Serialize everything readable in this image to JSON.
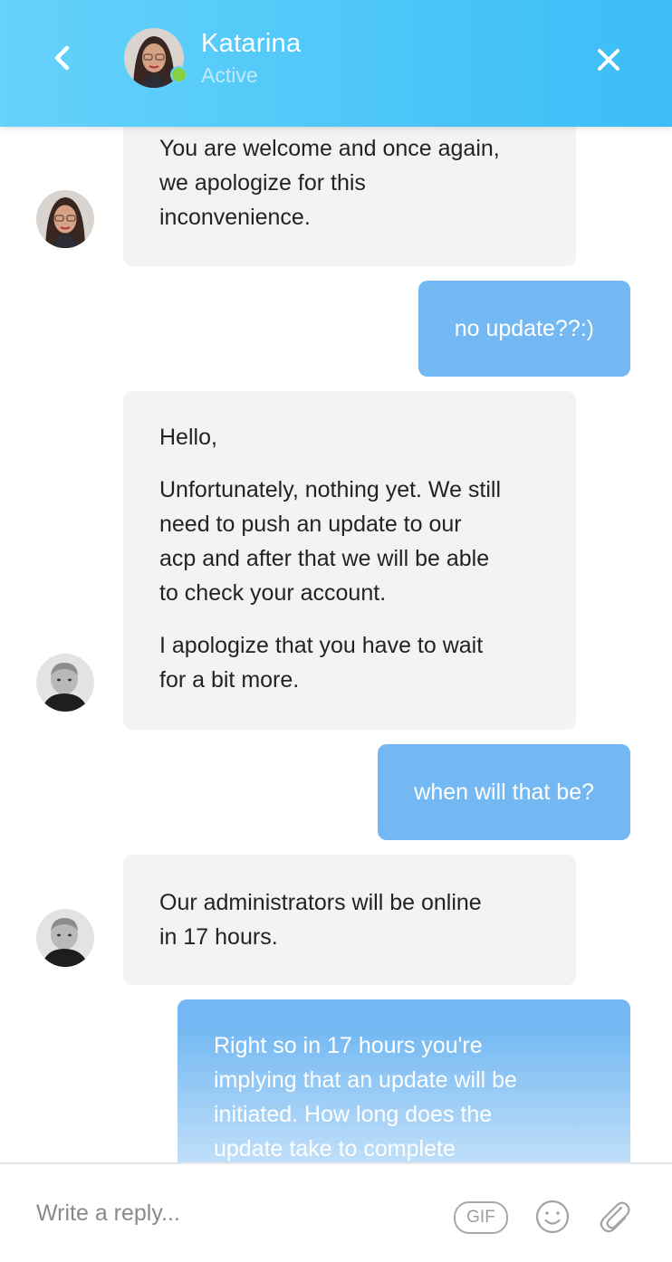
{
  "header": {
    "name": "Katarina",
    "status": "Active"
  },
  "icons": {
    "back": "chevron-left-icon",
    "close": "close-icon",
    "gif": "gif-icon",
    "emoji": "smiley-icon",
    "attach": "paperclip-icon"
  },
  "colors": {
    "header_gradient_start": "#64d2fb",
    "header_gradient_end": "#3cbdf6",
    "incoming_bubble": "#f3f3f3",
    "outgoing_bubble": "#73b8f2",
    "online_dot": "#86d140"
  },
  "messages": [
    {
      "from": "agent",
      "lines": [
        "You are welcome and once again,",
        "we apologize for this",
        "inconvenience."
      ]
    },
    {
      "from": "user",
      "lines": [
        "no update??:)"
      ]
    },
    {
      "from": "agent",
      "paragraphs": [
        [
          "Hello,"
        ],
        [
          "Unfortunately, nothing yet. We still",
          "need to push an update to our",
          "acp and after that we will be able",
          "to check your account."
        ],
        [
          "I apologize that you have to wait",
          "for a bit more."
        ]
      ]
    },
    {
      "from": "user",
      "lines": [
        "when will that be?"
      ]
    },
    {
      "from": "agent",
      "lines": [
        "Our administrators will be online",
        "in 17 hours."
      ]
    },
    {
      "from": "user",
      "lines": [
        "Right so in 17 hours you're",
        "implying that an update will be",
        "initiated. How long does the",
        "update take to complete"
      ]
    }
  ],
  "composer": {
    "placeholder": "Write a reply...",
    "gif_label": "GIF"
  }
}
